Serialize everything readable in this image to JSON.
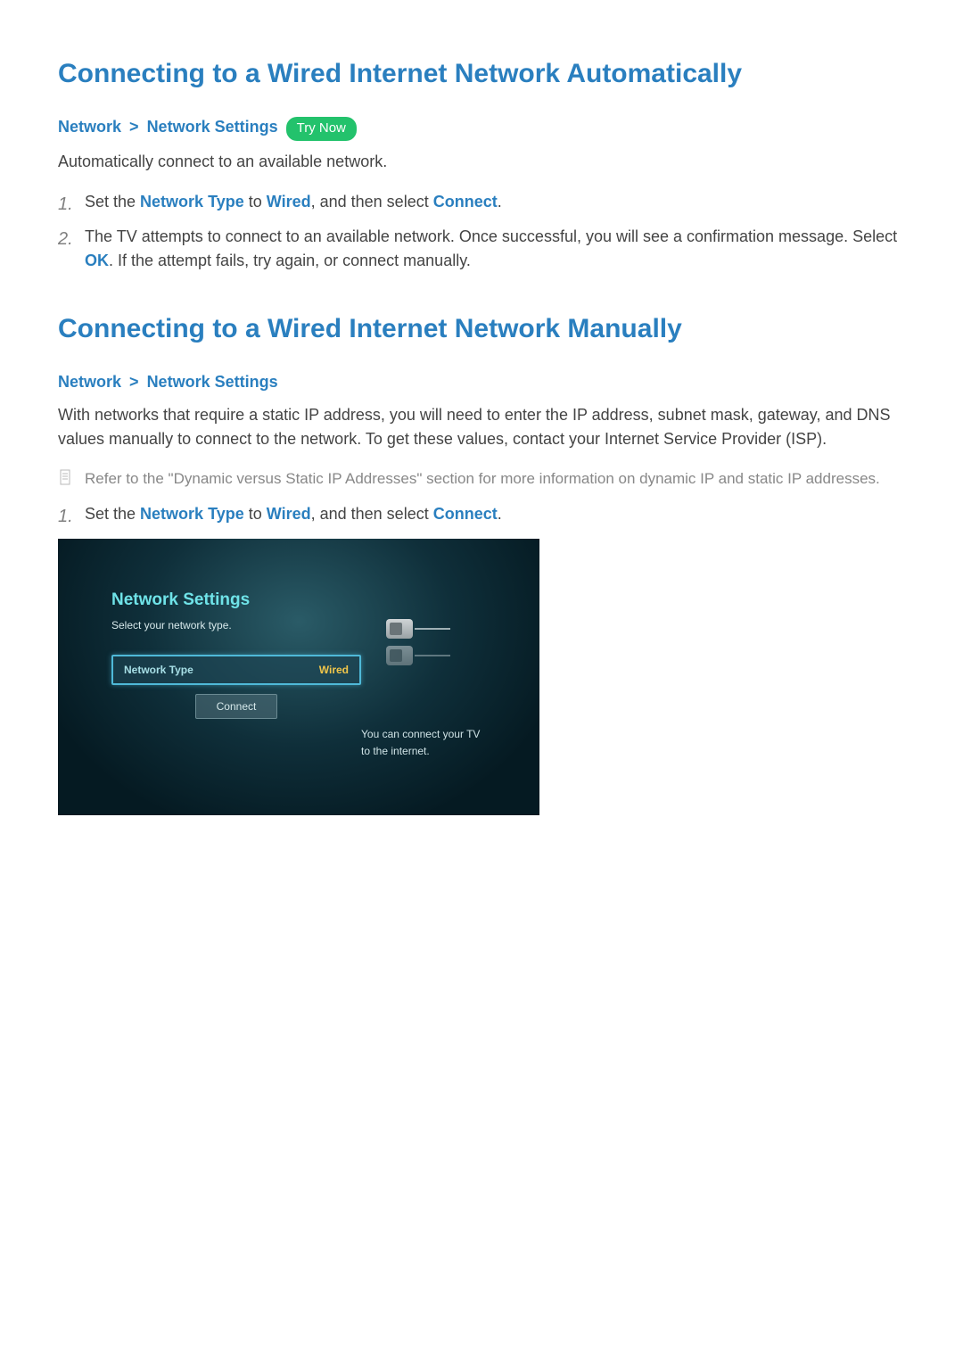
{
  "section1": {
    "heading": "Connecting to a Wired Internet Network Automatically",
    "breadcrumb": {
      "a": "Network",
      "b": "Network Settings"
    },
    "try_now": "Try Now",
    "intro": "Automatically connect to an available network.",
    "steps": [
      {
        "num": "1.",
        "pre": "Set the ",
        "hl1": "Network Type",
        "mid": " to ",
        "hl2": "Wired",
        "mid2": ", and then select ",
        "hl3": "Connect",
        "post": "."
      },
      {
        "num": "2.",
        "pre": "The TV attempts to connect to an available network. Once successful, you will see a confirmation message. Select ",
        "hl1": "OK",
        "post": ". If the attempt fails, try again, or connect manually."
      }
    ]
  },
  "section2": {
    "heading": "Connecting to a Wired Internet Network Manually",
    "breadcrumb": {
      "a": "Network",
      "b": "Network Settings"
    },
    "intro": "With networks that require a static IP address, you will need to enter the IP address, subnet mask, gateway, and DNS values manually to connect to the network. To get these values, contact your Internet Service Provider (ISP).",
    "note": "Refer to the \"Dynamic versus Static IP Addresses\" section for more information on dynamic IP and static IP addresses.",
    "steps": [
      {
        "num": "1.",
        "pre": "Set the ",
        "hl1": "Network Type",
        "mid": " to ",
        "hl2": "Wired",
        "mid2": ", and then select ",
        "hl3": "Connect",
        "post": "."
      }
    ]
  },
  "tv": {
    "title": "Network Settings",
    "subtitle": "Select your network type.",
    "row_label": "Network Type",
    "row_value": "Wired",
    "connect": "Connect",
    "info1": "You can connect your TV",
    "info2": "to the internet."
  }
}
